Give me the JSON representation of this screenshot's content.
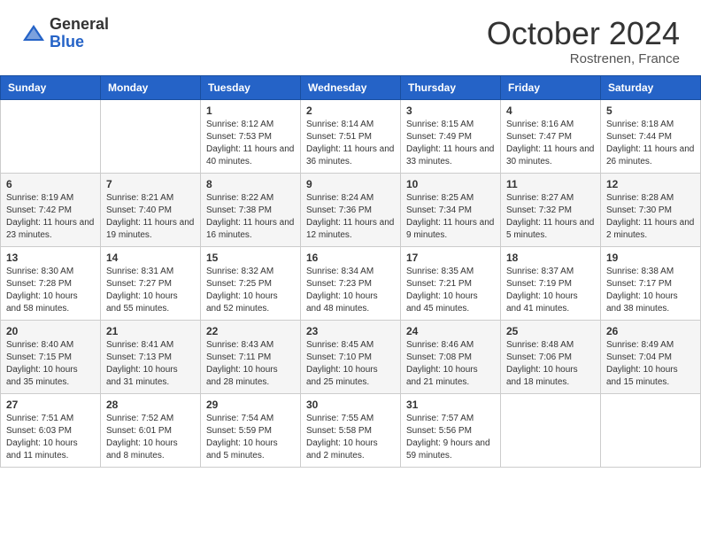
{
  "header": {
    "logo_general": "General",
    "logo_blue": "Blue",
    "month_title": "October 2024",
    "subtitle": "Rostrenen, France"
  },
  "days_of_week": [
    "Sunday",
    "Monday",
    "Tuesday",
    "Wednesday",
    "Thursday",
    "Friday",
    "Saturday"
  ],
  "weeks": [
    [
      {
        "day": "",
        "info": ""
      },
      {
        "day": "",
        "info": ""
      },
      {
        "day": "1",
        "info": "Sunrise: 8:12 AM\nSunset: 7:53 PM\nDaylight: 11 hours and 40 minutes."
      },
      {
        "day": "2",
        "info": "Sunrise: 8:14 AM\nSunset: 7:51 PM\nDaylight: 11 hours and 36 minutes."
      },
      {
        "day": "3",
        "info": "Sunrise: 8:15 AM\nSunset: 7:49 PM\nDaylight: 11 hours and 33 minutes."
      },
      {
        "day": "4",
        "info": "Sunrise: 8:16 AM\nSunset: 7:47 PM\nDaylight: 11 hours and 30 minutes."
      },
      {
        "day": "5",
        "info": "Sunrise: 8:18 AM\nSunset: 7:44 PM\nDaylight: 11 hours and 26 minutes."
      }
    ],
    [
      {
        "day": "6",
        "info": "Sunrise: 8:19 AM\nSunset: 7:42 PM\nDaylight: 11 hours and 23 minutes."
      },
      {
        "day": "7",
        "info": "Sunrise: 8:21 AM\nSunset: 7:40 PM\nDaylight: 11 hours and 19 minutes."
      },
      {
        "day": "8",
        "info": "Sunrise: 8:22 AM\nSunset: 7:38 PM\nDaylight: 11 hours and 16 minutes."
      },
      {
        "day": "9",
        "info": "Sunrise: 8:24 AM\nSunset: 7:36 PM\nDaylight: 11 hours and 12 minutes."
      },
      {
        "day": "10",
        "info": "Sunrise: 8:25 AM\nSunset: 7:34 PM\nDaylight: 11 hours and 9 minutes."
      },
      {
        "day": "11",
        "info": "Sunrise: 8:27 AM\nSunset: 7:32 PM\nDaylight: 11 hours and 5 minutes."
      },
      {
        "day": "12",
        "info": "Sunrise: 8:28 AM\nSunset: 7:30 PM\nDaylight: 11 hours and 2 minutes."
      }
    ],
    [
      {
        "day": "13",
        "info": "Sunrise: 8:30 AM\nSunset: 7:28 PM\nDaylight: 10 hours and 58 minutes."
      },
      {
        "day": "14",
        "info": "Sunrise: 8:31 AM\nSunset: 7:27 PM\nDaylight: 10 hours and 55 minutes."
      },
      {
        "day": "15",
        "info": "Sunrise: 8:32 AM\nSunset: 7:25 PM\nDaylight: 10 hours and 52 minutes."
      },
      {
        "day": "16",
        "info": "Sunrise: 8:34 AM\nSunset: 7:23 PM\nDaylight: 10 hours and 48 minutes."
      },
      {
        "day": "17",
        "info": "Sunrise: 8:35 AM\nSunset: 7:21 PM\nDaylight: 10 hours and 45 minutes."
      },
      {
        "day": "18",
        "info": "Sunrise: 8:37 AM\nSunset: 7:19 PM\nDaylight: 10 hours and 41 minutes."
      },
      {
        "day": "19",
        "info": "Sunrise: 8:38 AM\nSunset: 7:17 PM\nDaylight: 10 hours and 38 minutes."
      }
    ],
    [
      {
        "day": "20",
        "info": "Sunrise: 8:40 AM\nSunset: 7:15 PM\nDaylight: 10 hours and 35 minutes."
      },
      {
        "day": "21",
        "info": "Sunrise: 8:41 AM\nSunset: 7:13 PM\nDaylight: 10 hours and 31 minutes."
      },
      {
        "day": "22",
        "info": "Sunrise: 8:43 AM\nSunset: 7:11 PM\nDaylight: 10 hours and 28 minutes."
      },
      {
        "day": "23",
        "info": "Sunrise: 8:45 AM\nSunset: 7:10 PM\nDaylight: 10 hours and 25 minutes."
      },
      {
        "day": "24",
        "info": "Sunrise: 8:46 AM\nSunset: 7:08 PM\nDaylight: 10 hours and 21 minutes."
      },
      {
        "day": "25",
        "info": "Sunrise: 8:48 AM\nSunset: 7:06 PM\nDaylight: 10 hours and 18 minutes."
      },
      {
        "day": "26",
        "info": "Sunrise: 8:49 AM\nSunset: 7:04 PM\nDaylight: 10 hours and 15 minutes."
      }
    ],
    [
      {
        "day": "27",
        "info": "Sunrise: 7:51 AM\nSunset: 6:03 PM\nDaylight: 10 hours and 11 minutes."
      },
      {
        "day": "28",
        "info": "Sunrise: 7:52 AM\nSunset: 6:01 PM\nDaylight: 10 hours and 8 minutes."
      },
      {
        "day": "29",
        "info": "Sunrise: 7:54 AM\nSunset: 5:59 PM\nDaylight: 10 hours and 5 minutes."
      },
      {
        "day": "30",
        "info": "Sunrise: 7:55 AM\nSunset: 5:58 PM\nDaylight: 10 hours and 2 minutes."
      },
      {
        "day": "31",
        "info": "Sunrise: 7:57 AM\nSunset: 5:56 PM\nDaylight: 9 hours and 59 minutes."
      },
      {
        "day": "",
        "info": ""
      },
      {
        "day": "",
        "info": ""
      }
    ]
  ]
}
